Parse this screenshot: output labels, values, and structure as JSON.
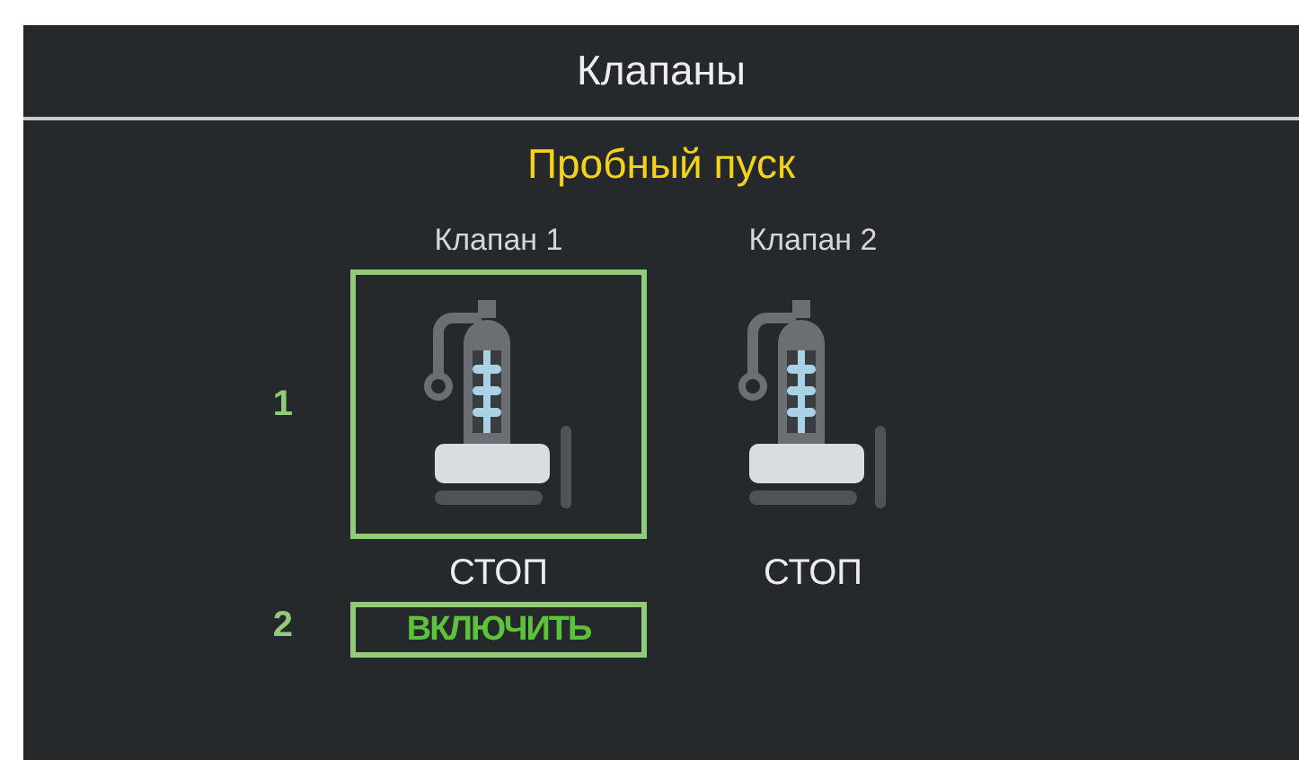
{
  "window": {
    "title": "Клапаны"
  },
  "mode": {
    "title": "Пробный пуск"
  },
  "valves": [
    {
      "name": "Клапан 1",
      "status": "СТОП",
      "highlighted": true,
      "annotation": "1",
      "button": {
        "label": "ВКЛЮЧИТЬ",
        "highlighted": true,
        "annotation": "2"
      }
    },
    {
      "name": "Клапан 2",
      "status": "СТОП",
      "highlighted": false
    }
  ]
}
